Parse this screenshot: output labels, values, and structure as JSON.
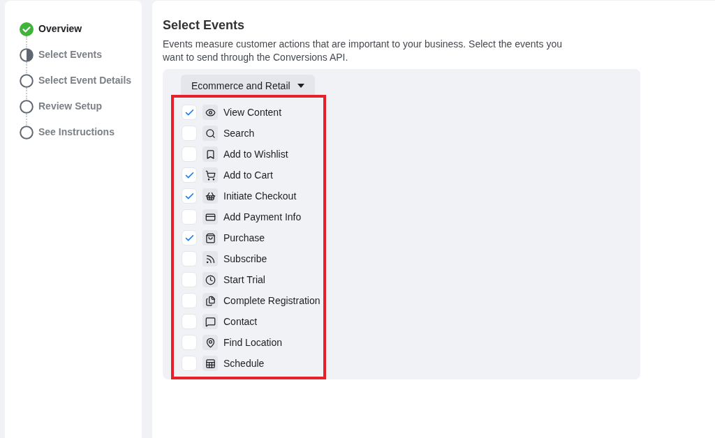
{
  "steps": [
    {
      "label": "Overview",
      "completed": true,
      "current": false
    },
    {
      "label": "Select Events",
      "completed": false,
      "current": true
    },
    {
      "label": "Select Event Details",
      "completed": false,
      "current": false
    },
    {
      "label": "Review Setup",
      "completed": false,
      "current": false
    },
    {
      "label": "See Instructions",
      "completed": false,
      "current": false
    }
  ],
  "title": "Select Events",
  "description": "Events measure customer actions that are important to your business. Select the events you want to send through the Conversions API.",
  "category_dropdown": "Ecommerce and Retail",
  "events": [
    {
      "label": "View Content",
      "kind": "eye",
      "checked": true
    },
    {
      "label": "Search",
      "kind": "search",
      "checked": false
    },
    {
      "label": "Add to Wishlist",
      "kind": "bookmark",
      "checked": false
    },
    {
      "label": "Add to Cart",
      "kind": "cart",
      "checked": true
    },
    {
      "label": "Initiate Checkout",
      "kind": "basket",
      "checked": true
    },
    {
      "label": "Add Payment Info",
      "kind": "card",
      "checked": false
    },
    {
      "label": "Purchase",
      "kind": "bag",
      "checked": true
    },
    {
      "label": "Subscribe",
      "kind": "feed",
      "checked": false
    },
    {
      "label": "Start Trial",
      "kind": "clock",
      "checked": false
    },
    {
      "label": "Complete Registration",
      "kind": "form",
      "checked": false
    },
    {
      "label": "Contact",
      "kind": "chat",
      "checked": false
    },
    {
      "label": "Find Location",
      "kind": "pin",
      "checked": false
    },
    {
      "label": "Schedule",
      "kind": "calendar",
      "checked": false
    }
  ]
}
